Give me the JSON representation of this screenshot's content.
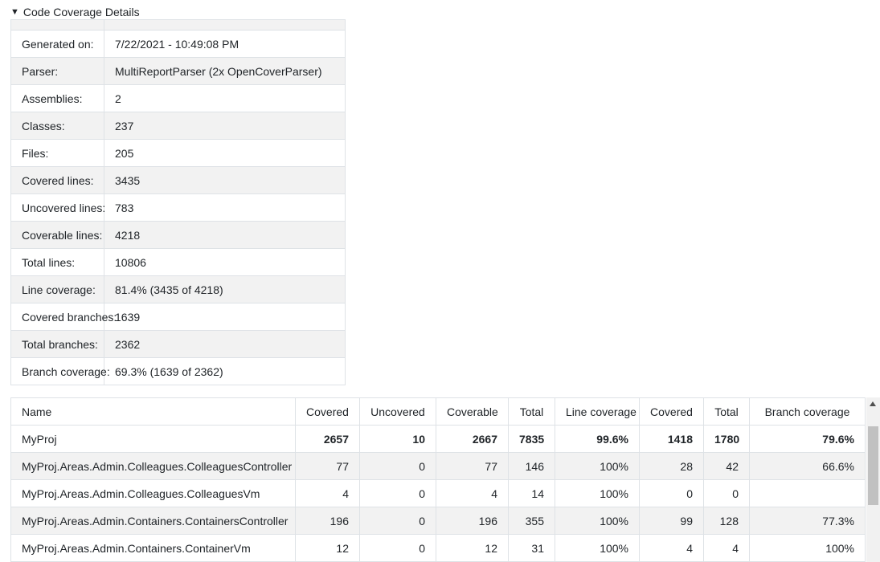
{
  "summary": {
    "toggle_icon": "triangle-down-icon",
    "title": "Code Coverage Details",
    "rows": [
      {
        "label": "Generated on:",
        "value": "7/22/2021 - 10:49:08 PM"
      },
      {
        "label": "Parser:",
        "value": "MultiReportParser (2x OpenCoverParser)"
      },
      {
        "label": "Assemblies:",
        "value": "2"
      },
      {
        "label": "Classes:",
        "value": "237"
      },
      {
        "label": "Files:",
        "value": "205"
      },
      {
        "label": "Covered lines:",
        "value": "3435"
      },
      {
        "label": "Uncovered lines:",
        "value": "783"
      },
      {
        "label": "Coverable lines:",
        "value": "4218"
      },
      {
        "label": "Total lines:",
        "value": "10806"
      },
      {
        "label": "Line coverage:",
        "value": "81.4% (3435 of 4218)"
      },
      {
        "label": "Covered branches:",
        "value": "1639"
      },
      {
        "label": "Total branches:",
        "value": "2362"
      },
      {
        "label": "Branch coverage:",
        "value": "69.3% (1639 of 2362)"
      }
    ]
  },
  "coverage": {
    "headers": [
      "Name",
      "Covered",
      "Uncovered",
      "Coverable",
      "Total",
      "Line coverage",
      "Covered",
      "Total",
      "Branch coverage"
    ],
    "rows": [
      [
        "MyProj",
        "2657",
        "10",
        "2667",
        "7835",
        "99.6%",
        "1418",
        "1780",
        "79.6%"
      ],
      [
        "MyProj.Areas.Admin.Colleagues.ColleaguesController",
        "77",
        "0",
        "77",
        "146",
        "100%",
        "28",
        "42",
        "66.6%"
      ],
      [
        "MyProj.Areas.Admin.Colleagues.ColleaguesVm",
        "4",
        "0",
        "4",
        "14",
        "100%",
        "0",
        "0",
        ""
      ],
      [
        "MyProj.Areas.Admin.Containers.ContainersController",
        "196",
        "0",
        "196",
        "355",
        "100%",
        "99",
        "128",
        "77.3%"
      ],
      [
        "MyProj.Areas.Admin.Containers.ContainerVm",
        "12",
        "0",
        "12",
        "31",
        "100%",
        "4",
        "4",
        "100%"
      ]
    ]
  },
  "colors": {
    "border": "#dee2e6",
    "stripe": "#f2f2f2",
    "text": "#212529",
    "scrollbar_track": "#f1f1f1",
    "scrollbar_thumb": "#c1c1c1"
  }
}
